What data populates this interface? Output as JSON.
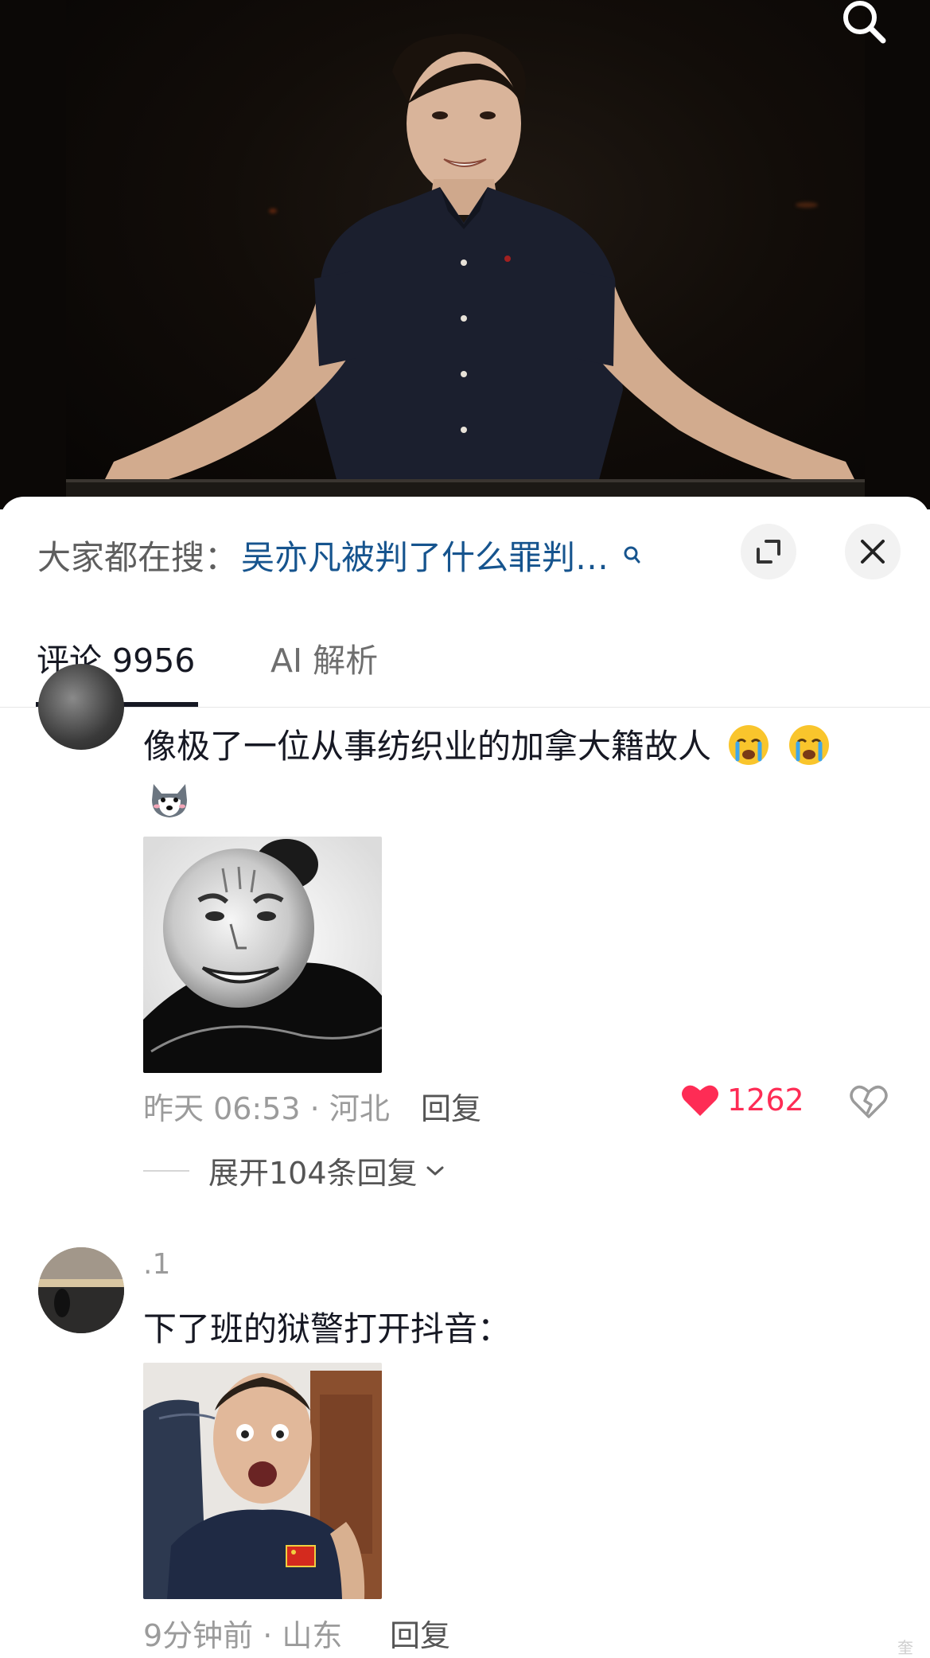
{
  "hot_search": {
    "label": "大家都在搜：",
    "link": "吴亦凡被判了什么罪判…"
  },
  "tabs": [
    {
      "label": "评论 9956",
      "active": true
    },
    {
      "label": "AI 解析",
      "active": false
    }
  ],
  "comments": [
    {
      "username": "",
      "text": "像极了一位从事纺织业的加拿大籍故人",
      "emojis": [
        "crying-face",
        "crying-face",
        "wolf-face"
      ],
      "meta": "昨天 06:53 · 河北",
      "reply_label": "回复",
      "likes": "1262",
      "liked": true,
      "expand_replies": "展开104条回复"
    },
    {
      "username": ".1",
      "text": "下了班的狱警打开抖音：",
      "meta": "9分钟前 · 山东",
      "reply_label": "回复"
    }
  ],
  "watermark": "奎",
  "colors": {
    "link": "#16548e",
    "like": "#fe2c55",
    "text": "#161823",
    "muted": "#9b9b9b"
  }
}
